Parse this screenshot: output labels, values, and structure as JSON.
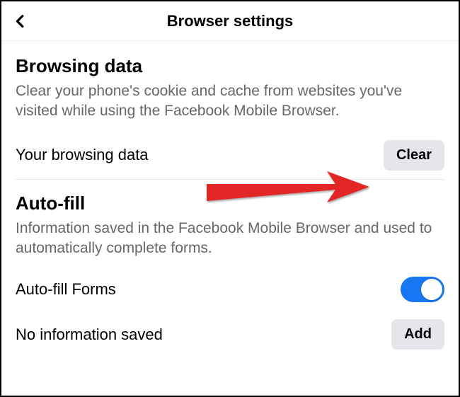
{
  "header": {
    "title": "Browser settings"
  },
  "browsing": {
    "title": "Browsing data",
    "desc": "Clear your phone's cookie and cache from websites you've visited while using the Facebook Mobile Browser.",
    "row_label": "Your browsing data",
    "clear_label": "Clear"
  },
  "autofill": {
    "title": "Auto-fill",
    "desc": "Information saved in the Facebook Mobile Browser and used to automatically complete forms.",
    "forms_label": "Auto-fill Forms",
    "no_info_label": "No information saved",
    "add_label": "Add"
  }
}
